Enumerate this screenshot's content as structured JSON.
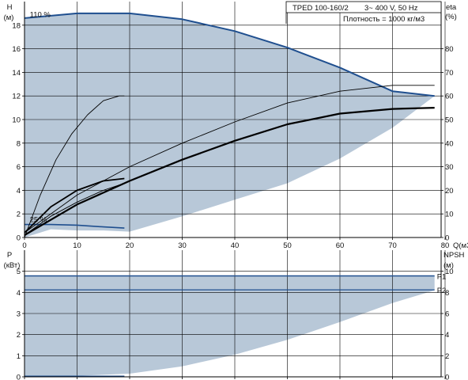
{
  "header": {
    "model": "TPED 100-160/2",
    "power": "3~ 400 V, 50 Hz",
    "density": "Плотность = 1000 кг/м3"
  },
  "colors": {
    "region_fill": "#b8c8d8",
    "curve_blue": "#1f4f8f",
    "curve_black": "#000000",
    "grid": "#000000"
  },
  "chart_data": [
    {
      "type": "line",
      "panel": "head-efficiency",
      "xlabel": "Q(м3/ч)",
      "xlim": [
        0,
        80
      ],
      "x_ticks": [
        0,
        10,
        20,
        30,
        40,
        50,
        60,
        70,
        80
      ],
      "x_tick_labels": [
        "0",
        "10",
        "20",
        "30",
        "40",
        "50",
        "60",
        "70",
        "80"
      ],
      "left_axis": {
        "label_top": "H",
        "label_unit": "(м)",
        "ylim": [
          0,
          20
        ],
        "ticks": [
          0,
          2,
          4,
          6,
          8,
          10,
          12,
          14,
          16,
          18
        ],
        "tick_labels": [
          "0",
          "2",
          "4",
          "6",
          "8",
          "10",
          "12",
          "14",
          "16",
          "18"
        ]
      },
      "right_axis": {
        "label_top": "eta",
        "label_unit": "(%)",
        "ylim": [
          0,
          100
        ],
        "ticks": [
          0,
          10,
          20,
          30,
          40,
          50,
          60,
          70,
          80
        ],
        "tick_labels": [
          "0",
          "10",
          "20",
          "30",
          "40",
          "50",
          "60",
          "70",
          "80"
        ]
      },
      "annotations": [
        "110 %",
        "25 %"
      ],
      "operating_region": {
        "upper_h_110pct": {
          "x": [
            0,
            10,
            20,
            30,
            40,
            50,
            60,
            70,
            78
          ],
          "y": [
            18.6,
            19.0,
            19.0,
            18.5,
            17.5,
            16.1,
            14.4,
            12.4,
            12.0
          ]
        },
        "lower_boundary": {
          "x": [
            0,
            5,
            10,
            15,
            20,
            30,
            40,
            50,
            60,
            70,
            78
          ],
          "y": [
            0.0,
            0.7,
            0.6,
            0.6,
            0.5,
            1.8,
            3.2,
            4.6,
            6.7,
            9.3,
            12.0
          ]
        }
      },
      "series": [
        {
          "name": "",
          "axis": "left",
          "color": "#1f4f8f",
          "width": 2.0,
          "x": [
            0,
            10,
            20,
            30,
            40,
            50,
            60,
            70,
            78
          ],
          "y": [
            18.6,
            19.0,
            19.0,
            18.5,
            17.5,
            16.1,
            14.4,
            12.4,
            12.0
          ]
        },
        {
          "name": "",
          "axis": "left",
          "color": "#1f4f8f",
          "width": 1.6,
          "x": [
            0,
            5,
            10,
            15,
            19
          ],
          "y": [
            1.1,
            1.1,
            1.05,
            0.9,
            0.8
          ]
        },
        {
          "name": "",
          "axis": "right",
          "color": "#000000",
          "width": 0.9,
          "x": [
            0,
            3,
            6,
            9,
            12,
            15,
            18,
            19
          ],
          "y": [
            0,
            18,
            33,
            44,
            52,
            58,
            60,
            60
          ]
        },
        {
          "name": "",
          "axis": "right",
          "color": "#000000",
          "width": 0.9,
          "x": [
            0,
            10,
            20,
            30,
            40,
            50,
            60,
            70,
            78
          ],
          "y": [
            2,
            18,
            30,
            40,
            49,
            57,
            62,
            64.5,
            64.5
          ]
        },
        {
          "name": "",
          "axis": "right",
          "color": "#000000",
          "width": 2.2,
          "x": [
            0,
            10,
            20,
            30,
            40,
            50,
            60,
            70,
            78
          ],
          "y": [
            1,
            14,
            24,
            33,
            41,
            48,
            52.5,
            54.5,
            55
          ]
        },
        {
          "name": "",
          "axis": "right",
          "color": "#000000",
          "width": 1.8,
          "x": [
            0,
            5,
            10,
            15,
            19
          ],
          "y": [
            2,
            13,
            20,
            24,
            25
          ]
        },
        {
          "name": "",
          "axis": "right",
          "color": "#000000",
          "width": 0.9,
          "x": [
            0,
            5,
            10,
            15,
            19
          ],
          "y": [
            1,
            9,
            15,
            20,
            23
          ]
        }
      ]
    },
    {
      "type": "line",
      "panel": "power-npsh",
      "xlim": [
        0,
        80
      ],
      "x_ticks": [
        0,
        10,
        20,
        30,
        40,
        50,
        60,
        70,
        80
      ],
      "left_axis": {
        "label_top": "P",
        "label_unit": "(кВт)",
        "ylim": [
          0,
          6
        ],
        "ticks": [
          0,
          1,
          2,
          3,
          4,
          5
        ],
        "tick_labels": [
          "0",
          "1",
          "2",
          "3",
          "4",
          "5"
        ]
      },
      "right_axis": {
        "label_top": "NPSH",
        "label_unit": "(м)",
        "ylim": [
          0,
          12
        ],
        "ticks": [
          0,
          2,
          4,
          6,
          8,
          10
        ],
        "tick_labels": [
          "0",
          "2",
          "4",
          "6",
          "8",
          "10"
        ]
      },
      "operating_region": {
        "upper_p": {
          "x": [
            0,
            78
          ],
          "y": [
            4.78,
            4.78
          ]
        },
        "lower_boundary": {
          "x": [
            0,
            10,
            20,
            30,
            40,
            50,
            60,
            70,
            78
          ],
          "y": [
            0.0,
            0.05,
            0.15,
            0.5,
            1.05,
            1.75,
            2.6,
            3.5,
            4.1
          ]
        }
      },
      "series": [
        {
          "name": "P1",
          "axis": "left",
          "color": "#1f4f8f",
          "width": 1.6,
          "x": [
            0,
            78
          ],
          "y": [
            4.78,
            4.78
          ]
        },
        {
          "name": "P2",
          "axis": "left",
          "color": "#1f4f8f",
          "width": 1.3,
          "x": [
            0,
            78
          ],
          "y": [
            4.12,
            4.12
          ]
        },
        {
          "name": "",
          "axis": "left",
          "color": "#1f4f8f",
          "width": 2.0,
          "x": [
            0,
            19
          ],
          "y": [
            0.02,
            0.02
          ]
        }
      ]
    }
  ]
}
